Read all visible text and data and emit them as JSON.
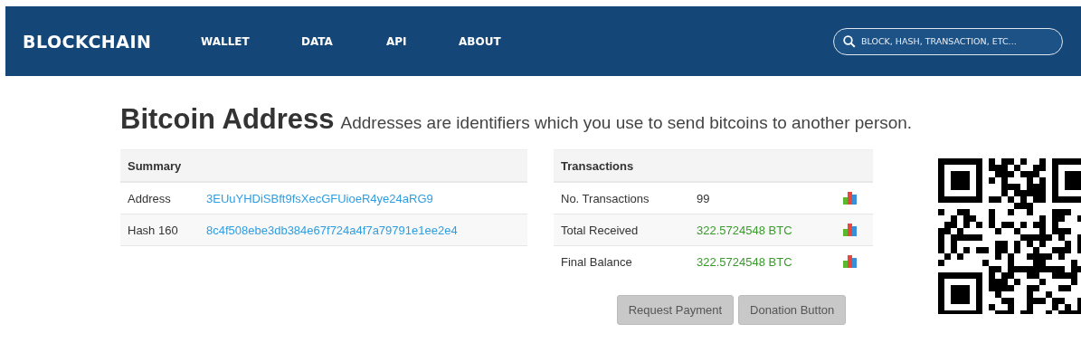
{
  "header": {
    "logo": "BLOCKCHAIN",
    "nav": [
      {
        "label": "WALLET"
      },
      {
        "label": "DATA"
      },
      {
        "label": "API"
      },
      {
        "label": "ABOUT"
      }
    ],
    "search": {
      "placeholder": "BLOCK, HASH, TRANSACTION, ETC..."
    }
  },
  "title": "Bitcoin Address",
  "subtitle": "Addresses are identifiers which you use to send bitcoins to another person.",
  "summary": {
    "heading": "Summary",
    "rows": [
      {
        "label": "Address",
        "value": "3EUuYHDiSBft9fsXecGFUioeR4ye24aRG9"
      },
      {
        "label": "Hash 160",
        "value": "8c4f508ebe3db384e67f724a4f7a79791e1ee2e4"
      }
    ]
  },
  "transactions": {
    "heading": "Transactions",
    "rows": [
      {
        "label": "No. Transactions",
        "value": "99",
        "kind": "count"
      },
      {
        "label": "Total Received",
        "value": "322.5724548 BTC",
        "kind": "amount"
      },
      {
        "label": "Final Balance",
        "value": "322.5724548 BTC",
        "kind": "amount"
      }
    ]
  },
  "buttons": [
    {
      "label": "Request Payment"
    },
    {
      "label": "Donation Button"
    }
  ],
  "qr_code": {
    "kind": "qr"
  }
}
